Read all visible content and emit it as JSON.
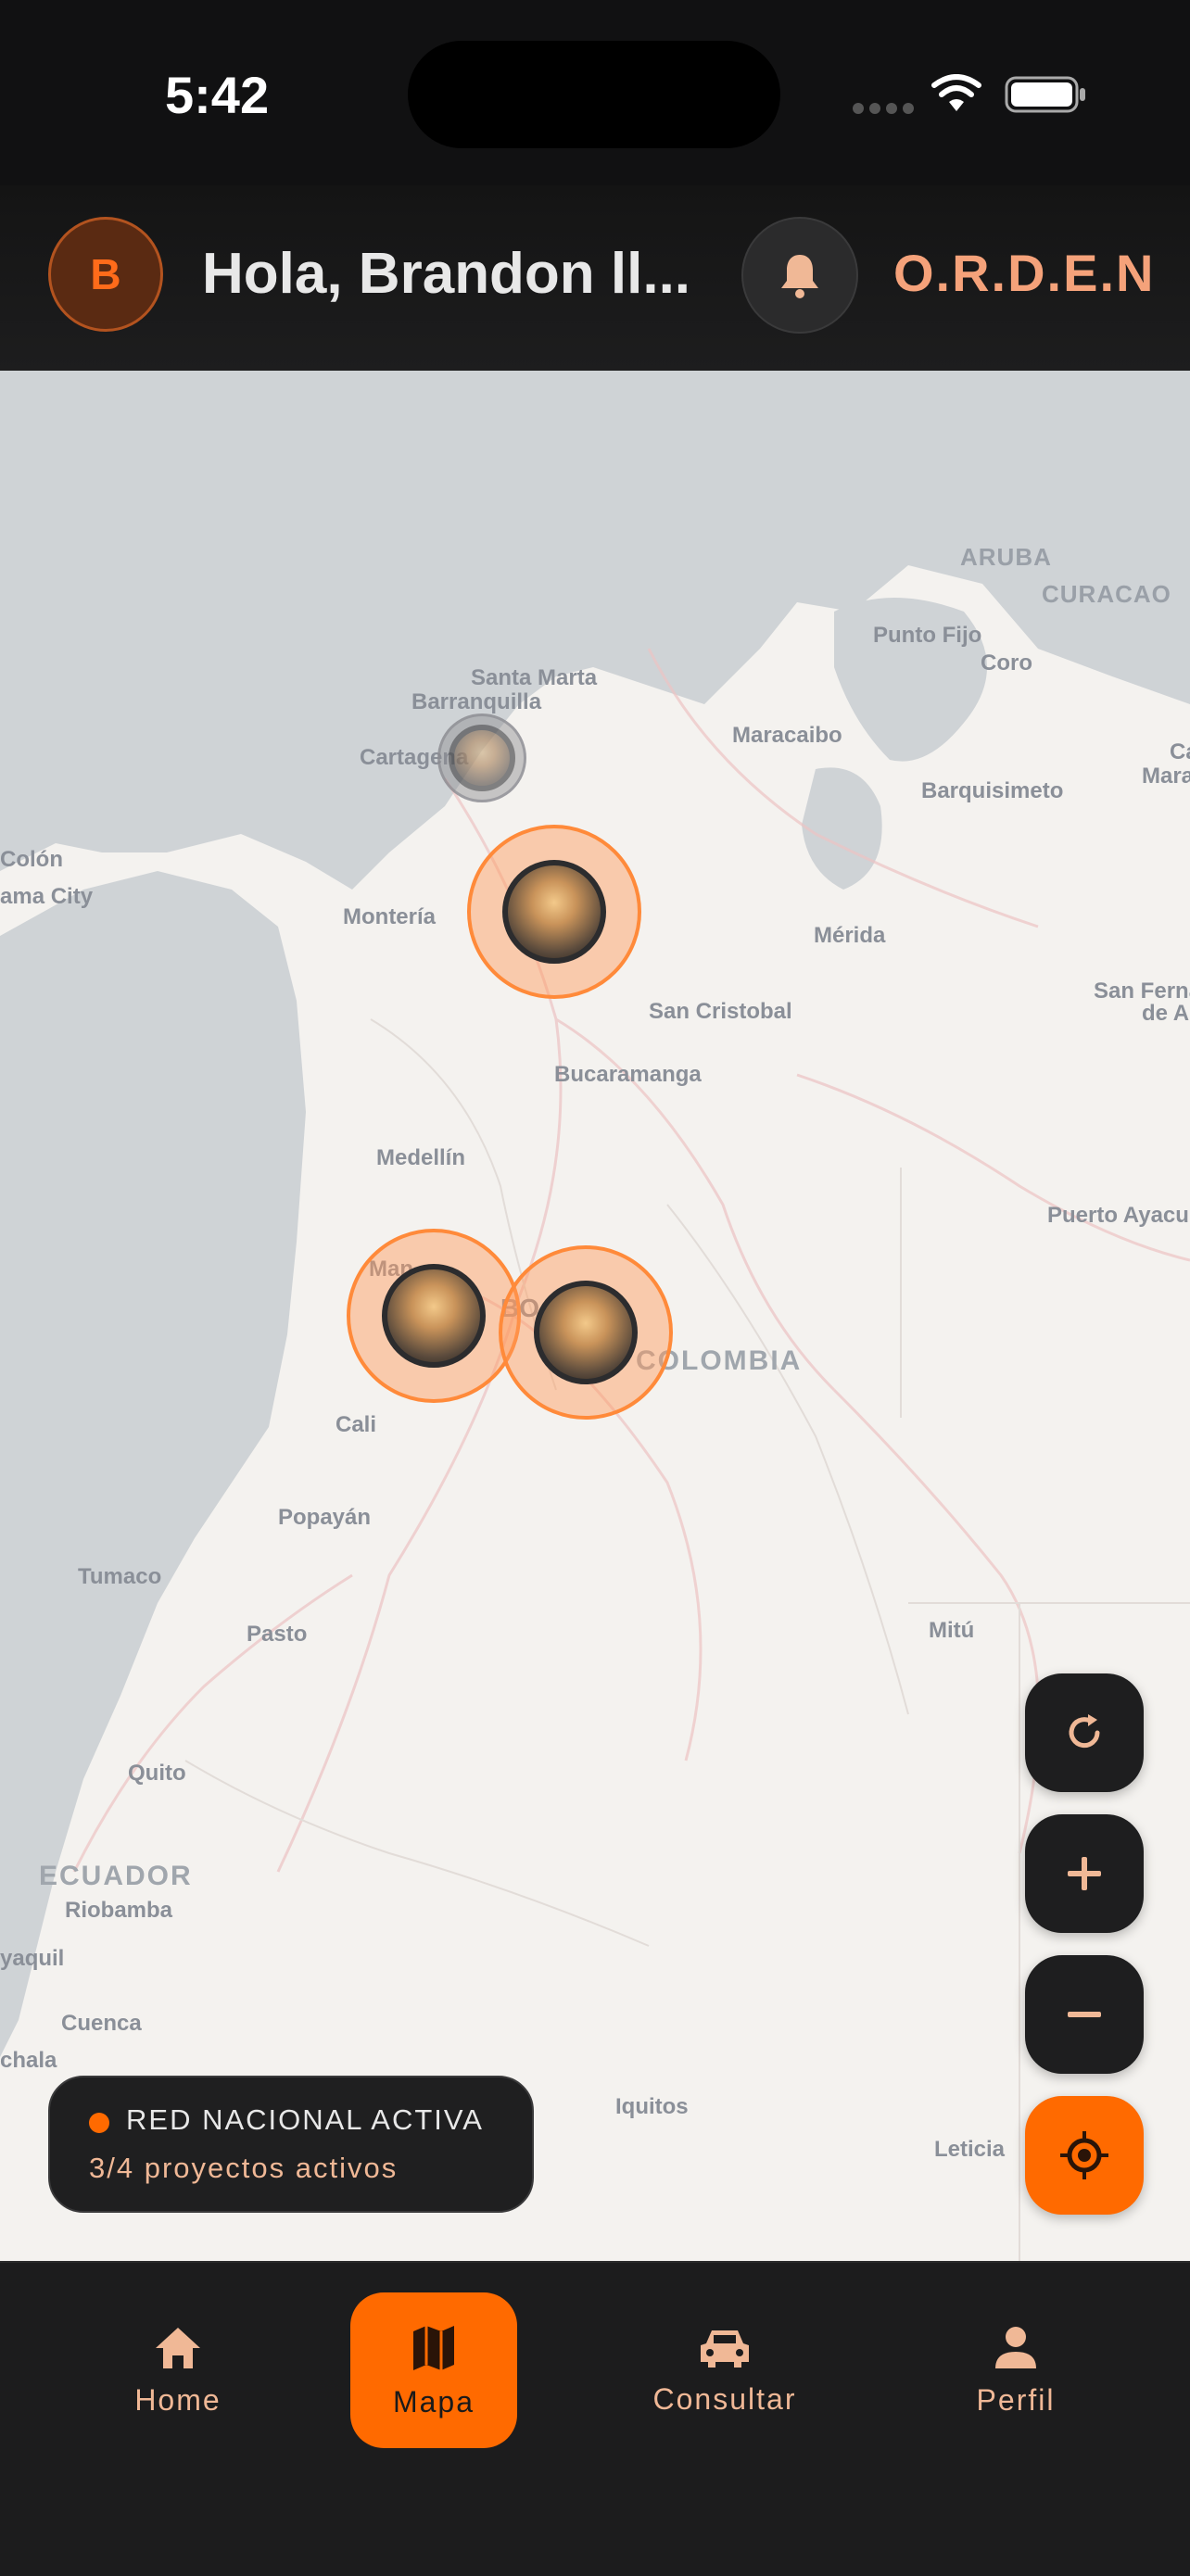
{
  "status_bar": {
    "time": "5:42"
  },
  "header": {
    "avatar_initial": "B",
    "greeting": "Hola, Brandon ll...",
    "brand": "O.R.D.E.N",
    "bell_icon": "bell-icon"
  },
  "map": {
    "labels": {
      "aruba": "ARUBA",
      "curacao": "CURACAO",
      "punto_fijo": "Punto Fijo",
      "coro": "Coro",
      "santa_marta": "Santa Marta",
      "barranquilla": "Barranquilla",
      "cartagena": "Cartagena",
      "maracaibo": "Maracaibo",
      "barquisimeto": "Barquisimeto",
      "colon": "Colón",
      "panama_city": "ama City",
      "monteria": "Montería",
      "merida": "Mérida",
      "san_cristobal": "San Cristobal",
      "san_fernando": "San Ferna",
      "san_fernando_2": "de A",
      "bucaramanga": "Bucaramanga",
      "medellin": "Medellín",
      "puerto_ayacucho": "Puerto Ayacu",
      "manizales": "Man",
      "bogota": "BO",
      "colombia": "COLOMBIA",
      "cali": "Cali",
      "popayan": "Popayán",
      "tumaco": "Tumaco",
      "pasto": "Pasto",
      "mitu": "Mitú",
      "quito": "Quito",
      "ecuador": "ECUADOR",
      "riobamba": "Riobamba",
      "guayaquil": "yaquil",
      "cuenca": "Cuenca",
      "machala": "chala",
      "iquitos": "Iquitos",
      "leticia": "Leticia",
      "mara": "Mara",
      "ca": "Ca"
    }
  },
  "network_card": {
    "title": "RED NACIONAL ACTIVA",
    "subtitle": "3/4 proyectos activos"
  },
  "fabs": {
    "refresh_icon": "refresh-icon",
    "zoom_in_icon": "plus-icon",
    "zoom_out_icon": "minus-icon",
    "locate_icon": "crosshair-icon"
  },
  "nav": {
    "items": [
      {
        "label": "Home",
        "icon": "home-icon"
      },
      {
        "label": "Mapa",
        "icon": "map-icon"
      },
      {
        "label": "Consultar",
        "icon": "car-icon"
      },
      {
        "label": "Perfil",
        "icon": "person-icon"
      }
    ],
    "active_index": 1
  },
  "colors": {
    "accent": "#ff6a00",
    "accent_soft": "#f5a27a",
    "background": "#111112",
    "map_land": "#f4f2ef",
    "map_water": "#cfd3d6"
  }
}
